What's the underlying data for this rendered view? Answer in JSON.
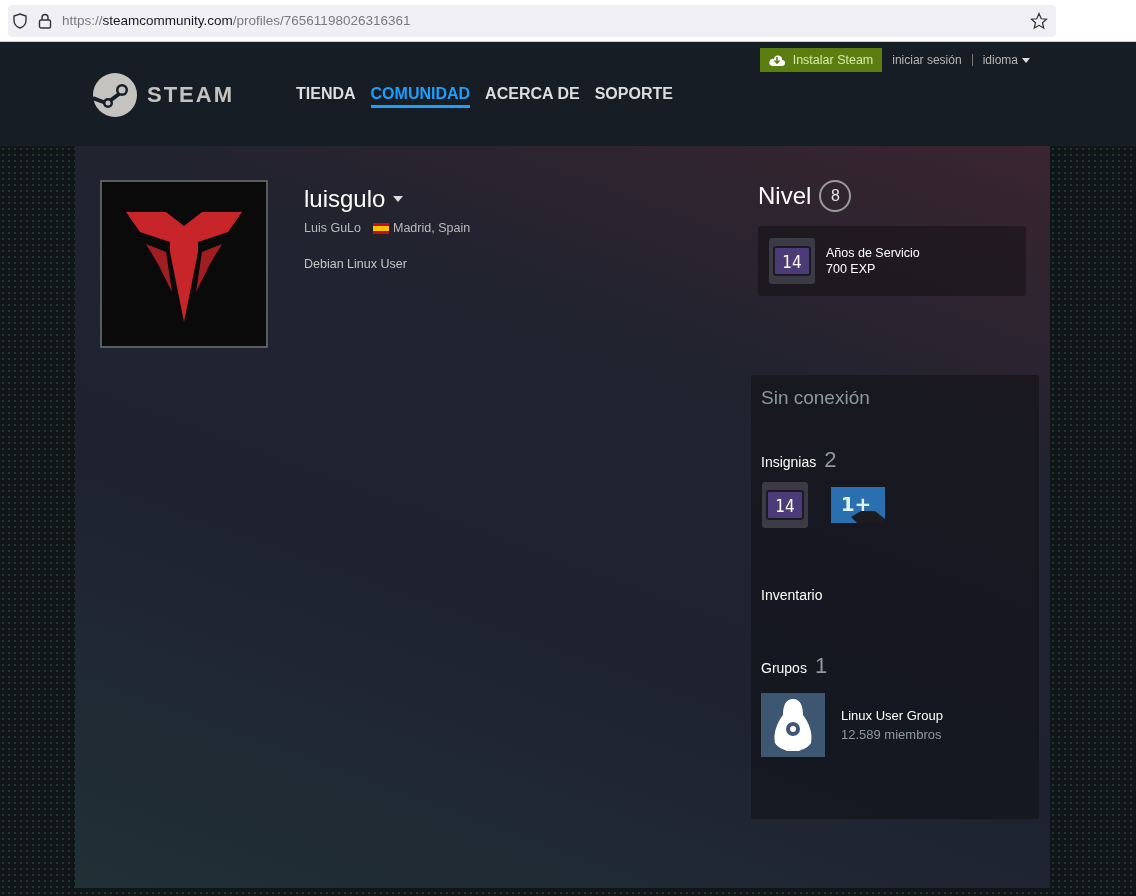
{
  "browser": {
    "url_parts": [
      {
        "text": "https://",
        "emphasis": false
      },
      {
        "text": "steamcommunity.com",
        "emphasis": true
      },
      {
        "text": "/profiles/76561198026316361",
        "emphasis": false
      }
    ]
  },
  "header": {
    "logo_text": "STEAM",
    "install_button": "Instalar Steam",
    "login_link": "iniciar sesión",
    "language_menu": "idioma",
    "nav": [
      {
        "label": "TIENDA",
        "selected": false
      },
      {
        "label": "COMUNIDAD",
        "selected": true
      },
      {
        "label": "ACERCA DE",
        "selected": false
      },
      {
        "label": "SOPORTE",
        "selected": false
      }
    ]
  },
  "profile": {
    "persona_name": "luisgulo",
    "real_name": "Luis GuLo",
    "location": "Madrid, Spain",
    "summary": "Debian Linux User"
  },
  "level": {
    "label": "Nivel",
    "value": "8",
    "featured_badge": {
      "badge_text": "14",
      "name": "Años de Servicio",
      "xp": "700 EXP"
    }
  },
  "sidebar": {
    "status": "Sin conexión",
    "badges": {
      "label": "Insignias",
      "count": "2",
      "items": [
        {
          "kind": "years",
          "text": "14"
        },
        {
          "kind": "plus",
          "text": "1+"
        }
      ]
    },
    "inventory": {
      "label": "Inventario"
    },
    "groups": {
      "label": "Grupos",
      "count": "1",
      "items": [
        {
          "name": "Linux User Group",
          "members": "12.589 miembros"
        }
      ]
    }
  }
}
